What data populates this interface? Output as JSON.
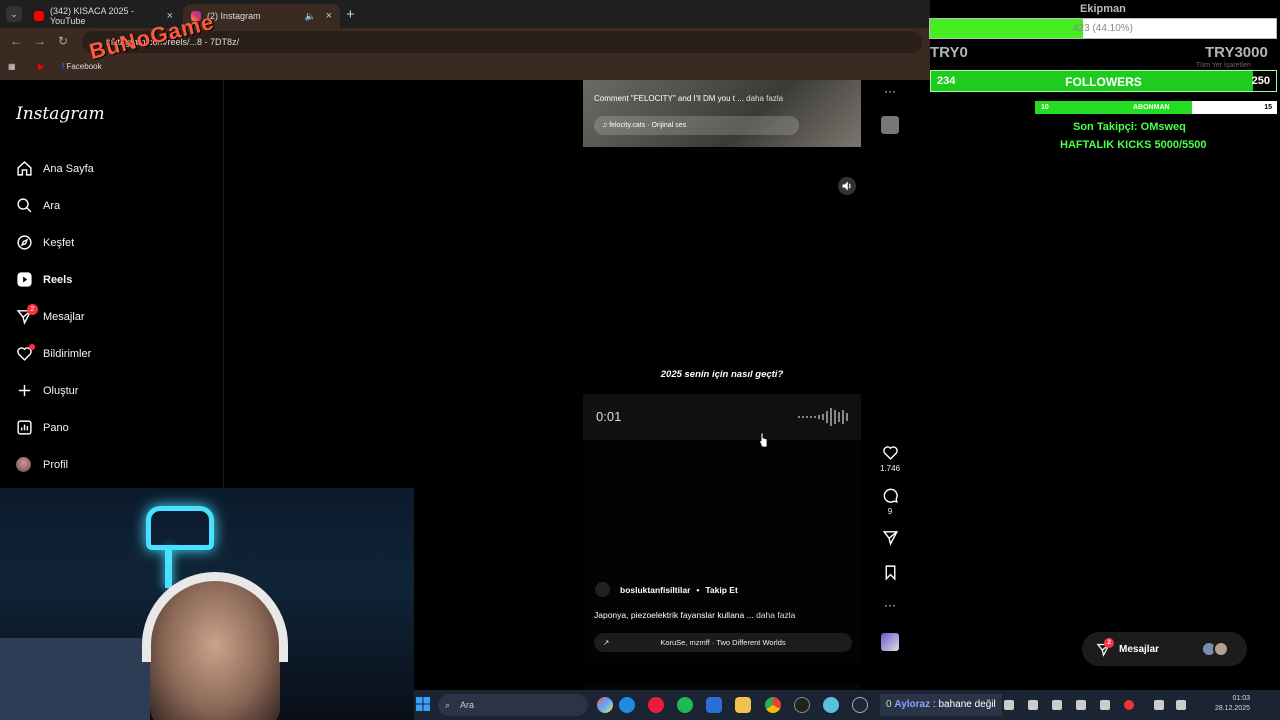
{
  "browser": {
    "tabs": [
      {
        "title": "(342) KISACA 2025 - YouTube",
        "icon": "youtube-icon"
      },
      {
        "title": "(2) Instagram",
        "icon": "instagram-icon"
      }
    ],
    "address": "instagram.com/reels/...8 - 7DT8z/",
    "bookmarks": [
      "Facebook"
    ],
    "bookmarks_right": "Tüm Yer İşaretleri",
    "overlay_logo": "BüNoGame"
  },
  "instagram": {
    "logo": "Instagram",
    "nav": [
      {
        "label": "Ana Sayfa",
        "icon": "home-icon"
      },
      {
        "label": "Ara",
        "icon": "search-icon"
      },
      {
        "label": "Keşfet",
        "icon": "compass-icon"
      },
      {
        "label": "Reels",
        "icon": "reels-icon"
      },
      {
        "label": "Mesajlar",
        "icon": "messenger-icon",
        "badge": "2"
      },
      {
        "label": "Bildirimler",
        "icon": "heart-icon"
      },
      {
        "label": "Oluştur",
        "icon": "plus-icon"
      },
      {
        "label": "Pano",
        "icon": "dashboard-icon"
      },
      {
        "label": "Profil",
        "icon": "avatar"
      }
    ]
  },
  "feed": {
    "reel1": {
      "caption": "Comment \"FELOCITY\" and I'll DM you t ...",
      "more": "daha fazla",
      "audio": "felocity.cats · Orijinal ses"
    },
    "reel2": {
      "text": "2025 senin için nasıl geçti?"
    },
    "voice": {
      "time": "0:01"
    },
    "reel3": {
      "username": "bosluktanfisiltilar",
      "follow": "Takip Et",
      "caption": "Japonya, piezoelektrik fayanslar kullana ...",
      "more": "daha fazla",
      "audio": "KoruSe, mzmff · Two Different Worlds"
    },
    "actions": {
      "likes": "1.746",
      "comments": "9"
    }
  },
  "overlays": {
    "streamer": "Ekipman",
    "goal_text": "(44.10%)",
    "goal_partial": "423",
    "goal_percent": 44.1,
    "try_left": "TRY0",
    "try_right": "TRY3000",
    "followers": {
      "current": "234",
      "label": "FOLLOWERS",
      "target": "250"
    },
    "subs": {
      "current": "10",
      "label": "ABONMAN",
      "target": "15"
    },
    "last_follower": "Son Takipçi: OMsweq",
    "weekly": "HAFTALIK KICKS 5000/5500"
  },
  "messages_pill": {
    "label": "Mesajlar",
    "badge": "2"
  },
  "taskbar": {
    "search_placeholder": "Ara",
    "chat_user": "Ayloraz",
    "chat_text": "bahane değil",
    "chat_count": "0",
    "time": "01:03",
    "date": "28.12.2025"
  },
  "colors": {
    "instagram_badge": "#ff3040",
    "overlay_green": "#22dd22",
    "neon": "#49e1ff"
  }
}
